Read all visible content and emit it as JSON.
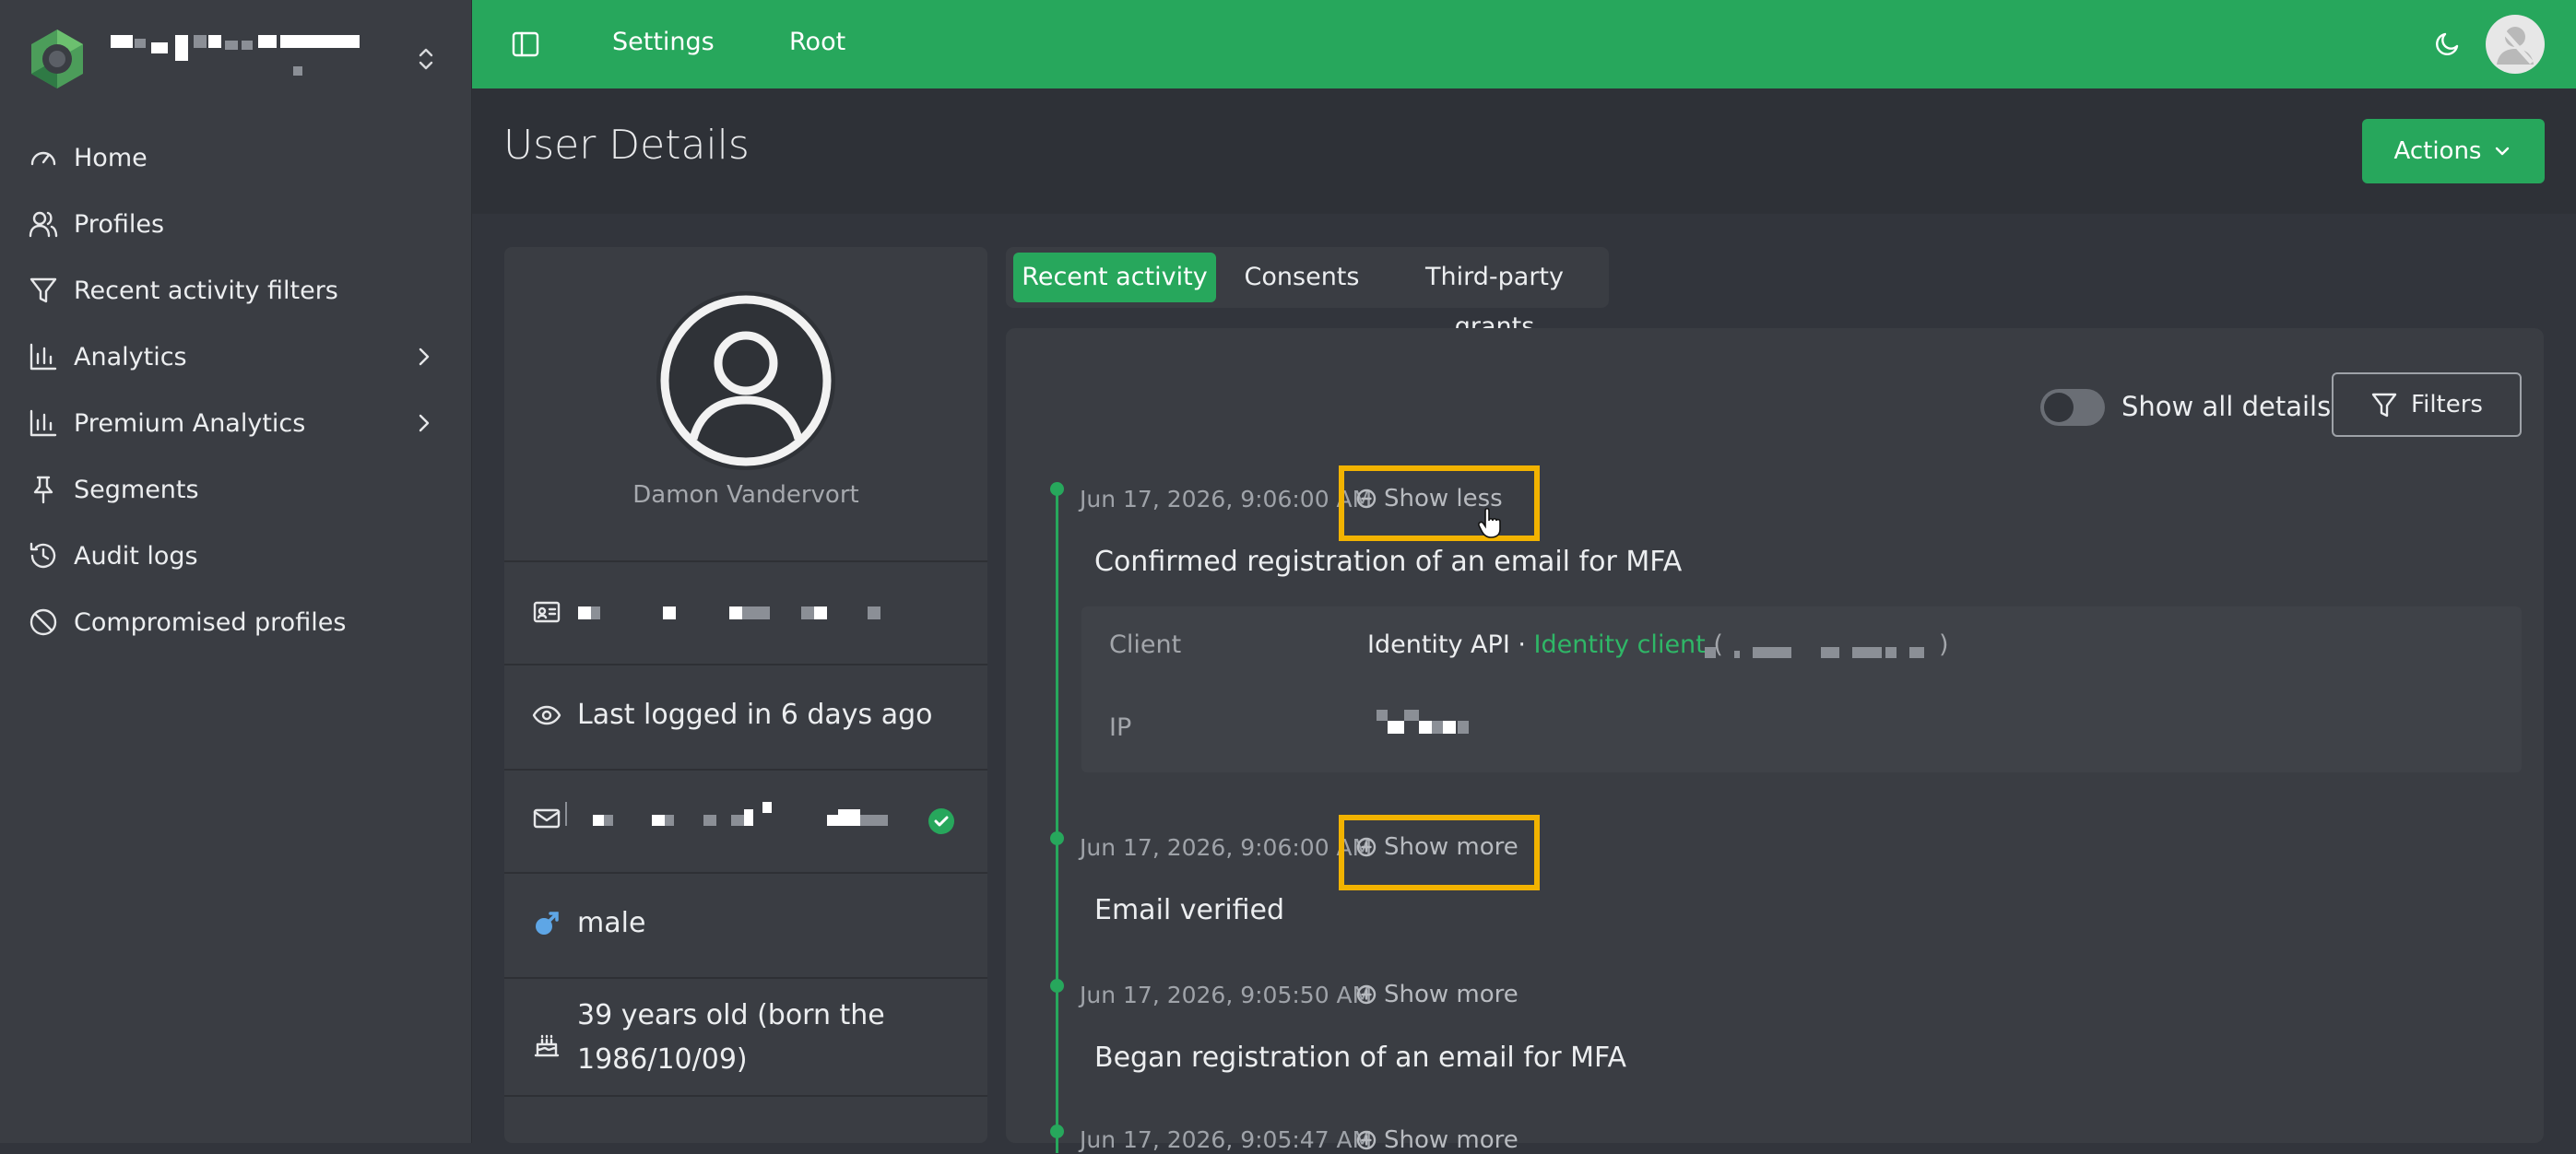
{
  "brand": {
    "name": "",
    "switcher_icon": "chevron-up-down-icon"
  },
  "sidebar": {
    "items": [
      {
        "label": "Home",
        "icon": "gauge-icon"
      },
      {
        "label": "Profiles",
        "icon": "users-icon"
      },
      {
        "label": "Recent activity filters",
        "icon": "funnel-icon"
      },
      {
        "label": "Analytics",
        "icon": "bar-chart-icon",
        "expandable": true
      },
      {
        "label": "Premium Analytics",
        "icon": "bar-chart-icon",
        "expandable": true
      },
      {
        "label": "Segments",
        "icon": "pin-icon"
      },
      {
        "label": "Audit logs",
        "icon": "history-icon"
      },
      {
        "label": "Compromised profiles",
        "icon": "ban-icon"
      }
    ]
  },
  "topbar": {
    "links": [
      "Settings",
      "Root"
    ],
    "theme_icon": "moon-icon"
  },
  "header": {
    "title": "User Details",
    "actions_label": "Actions"
  },
  "profile": {
    "name": "Damon Vandervort",
    "last_login": "Last logged in 6 days ago",
    "gender": "male",
    "birth_line1": "39 years old (born the",
    "birth_line2": "1986/10/09)"
  },
  "tabs": [
    {
      "label": "Recent activity",
      "active": true
    },
    {
      "label": "Consents",
      "active": false
    },
    {
      "label": "Third-party grants",
      "active": false
    }
  ],
  "activity": {
    "show_all_details_label": "Show all details",
    "show_all_details_on": false,
    "filters_label": "Filters",
    "events": [
      {
        "time": "Jun 17, 2026, 9:06:00 AM",
        "toggle": "Show less",
        "title": "Confirmed registration of an email for MFA"
      },
      {
        "time": "Jun 17, 2026, 9:06:00 AM",
        "toggle": "Show more",
        "title": "Email verified"
      },
      {
        "time": "Jun 17, 2026, 9:05:50 AM",
        "toggle": "Show more",
        "title": "Began registration of an email for MFA"
      },
      {
        "time": "Jun 17, 2026, 9:05:47 AM",
        "toggle": "Show more",
        "title": ""
      }
    ],
    "details": {
      "client_label": "Client",
      "client_value": "Identity API · ",
      "client_link": "Identity client",
      "client_paren_open": "(",
      "client_paren_close": ")",
      "ip_label": "IP"
    }
  },
  "colors": {
    "brand_green": "#27a75c",
    "highlight": "#f2b300",
    "sidebar_bg": "#3a3d43",
    "page_bg": "#32353c"
  }
}
